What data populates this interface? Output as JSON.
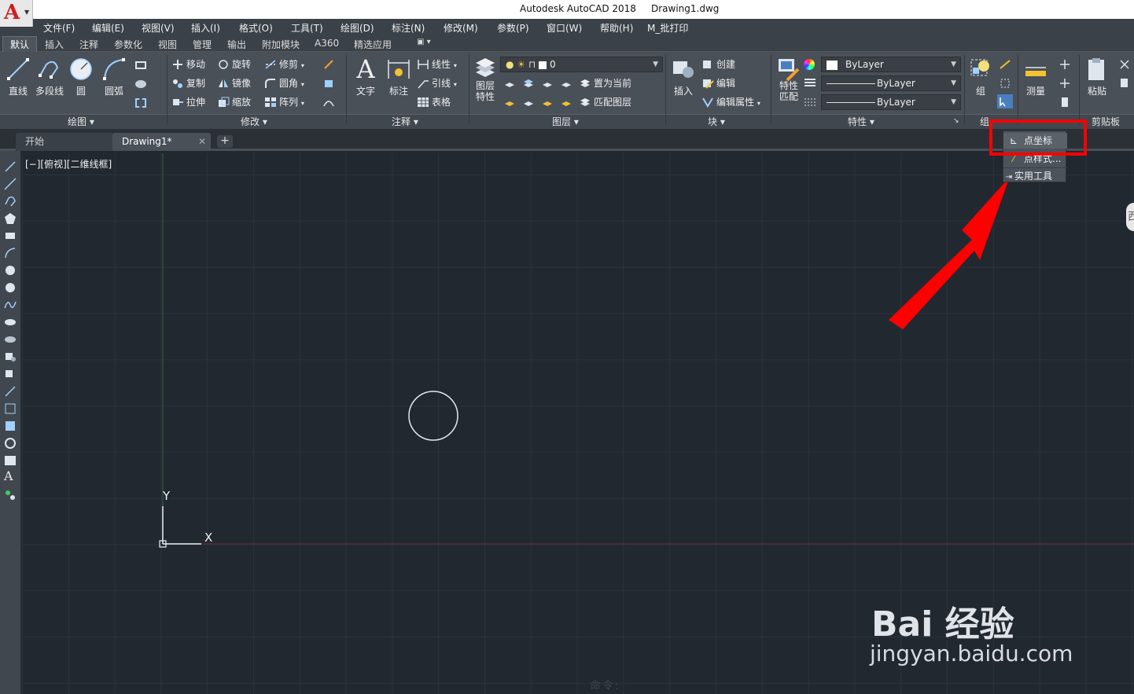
{
  "window": {
    "title": "Autodesk AutoCAD 2018     Drawing1.dwg",
    "logo_letter": "A",
    "logo_caret": "▼"
  },
  "menu": [
    "文件(F)",
    "编辑(E)",
    "视图(V)",
    "插入(I)",
    "格式(O)",
    "工具(T)",
    "绘图(D)",
    "标注(N)",
    "修改(M)",
    "参数(P)",
    "窗口(W)",
    "帮助(H)",
    "M_批打印"
  ],
  "ribbon_tabs": [
    "默认",
    "插入",
    "注释",
    "参数化",
    "视图",
    "管理",
    "输出",
    "附加模块",
    "A360",
    "精选应用",
    "▣ ▾"
  ],
  "ribbon": {
    "draw": {
      "line": "直线",
      "polyline": "多段线",
      "circle": "圆",
      "arc": "圆弧",
      "panel": "绘图 ▾"
    },
    "modify": {
      "move": "移动",
      "rotate": "旋转",
      "trim": "修剪",
      "copy": "复制",
      "mirror": "镜像",
      "fillet": "圆角",
      "stretch": "拉伸",
      "scale": "缩放",
      "array": "阵列",
      "panel": "修改 ▾"
    },
    "annotation": {
      "text": "文字",
      "dimension": "标注",
      "linear": "线性",
      "leader": "引线",
      "table": "表格",
      "panel": "注释 ▾"
    },
    "layers": {
      "layer_props_1": "图层",
      "layer_props_2": "特性",
      "current_layer": "0",
      "set_current": "置为当前",
      "match_layer": "匹配图层",
      "panel": "图层 ▾"
    },
    "block": {
      "insert": "插入",
      "create": "创建",
      "edit": "编辑",
      "edit_attr": "编辑属性",
      "panel": "块 ▾"
    },
    "properties": {
      "match_1": "特性",
      "match_2": "匹配",
      "color": "ByLayer",
      "linetype": "ByLayer",
      "lineweight": "ByLayer",
      "panel": "特性 ▾"
    },
    "groups": {
      "group": "组",
      "panel": "组"
    },
    "utilities": {
      "measure": "测量"
    },
    "clipboard": {
      "paste": "粘贴",
      "panel": "剪贴板"
    }
  },
  "doc_tabs": {
    "start": "开始",
    "drawing": "Drawing1*",
    "close": "✕",
    "new": "+"
  },
  "viewport_label": "[−][俯视][二维线框]",
  "popup": {
    "point_coords": "点坐标",
    "point_style": "点样式...",
    "utilities": "实用工具"
  },
  "ucs": {
    "x": "X",
    "y": "Y"
  },
  "command_line": "命令:",
  "watermark": {
    "brand": "Bai 经验",
    "url": "jingyan.baidu.com"
  },
  "right_edge": "西",
  "colors": {
    "canvas": "#212830",
    "annotation": "#ff0000",
    "accent_logo": "#cc1f1f"
  }
}
